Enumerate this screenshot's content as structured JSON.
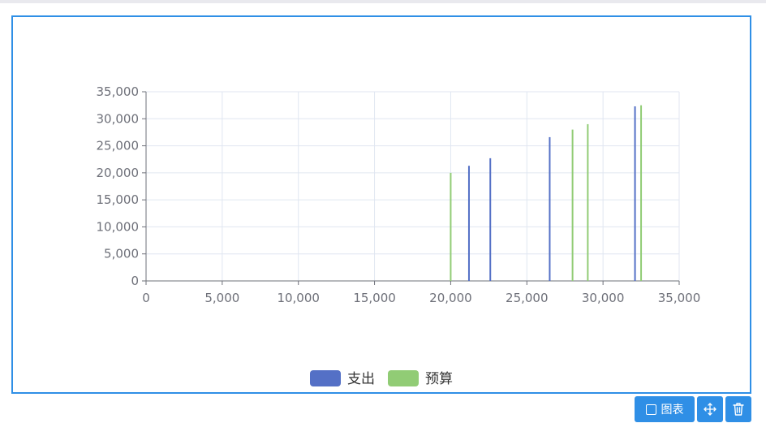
{
  "toolbar": {
    "chart_label": "图表",
    "chart_icon": "square-icon",
    "move_icon": "move-arrows-icon",
    "delete_icon": "trash-icon"
  },
  "colors": {
    "frame_border": "#2f8fe6",
    "button_bg": "#2f8fe6",
    "series_expense": "#5470c6",
    "series_budget": "#91cc75",
    "grid": "#e0e6f1",
    "axis": "#6e7079"
  },
  "chart_data": {
    "type": "bar",
    "title": "",
    "xlabel": "",
    "ylabel": "",
    "xlim": [
      0,
      35000
    ],
    "ylim": [
      0,
      35000
    ],
    "x_ticks": [
      "0",
      "5,000",
      "10,000",
      "15,000",
      "20,000",
      "25,000",
      "30,000",
      "35,000"
    ],
    "y_ticks": [
      "0",
      "5,000",
      "10,000",
      "15,000",
      "20,000",
      "25,000",
      "30,000",
      "35,000"
    ],
    "x_tick_values": [
      0,
      5000,
      10000,
      15000,
      20000,
      25000,
      30000,
      35000
    ],
    "y_tick_values": [
      0,
      5000,
      10000,
      15000,
      20000,
      25000,
      30000,
      35000
    ],
    "grid": true,
    "legend_position": "bottom-center",
    "series": [
      {
        "name": "支出",
        "color": "#5470c6",
        "points": [
          [
            21200,
            21300
          ],
          [
            22600,
            22700
          ],
          [
            26500,
            26600
          ],
          [
            32100,
            32300
          ]
        ]
      },
      {
        "name": "预算",
        "color": "#91cc75",
        "points": [
          [
            20000,
            20000
          ],
          [
            28000,
            28000
          ],
          [
            29000,
            29000
          ],
          [
            32500,
            32500
          ]
        ]
      }
    ]
  }
}
